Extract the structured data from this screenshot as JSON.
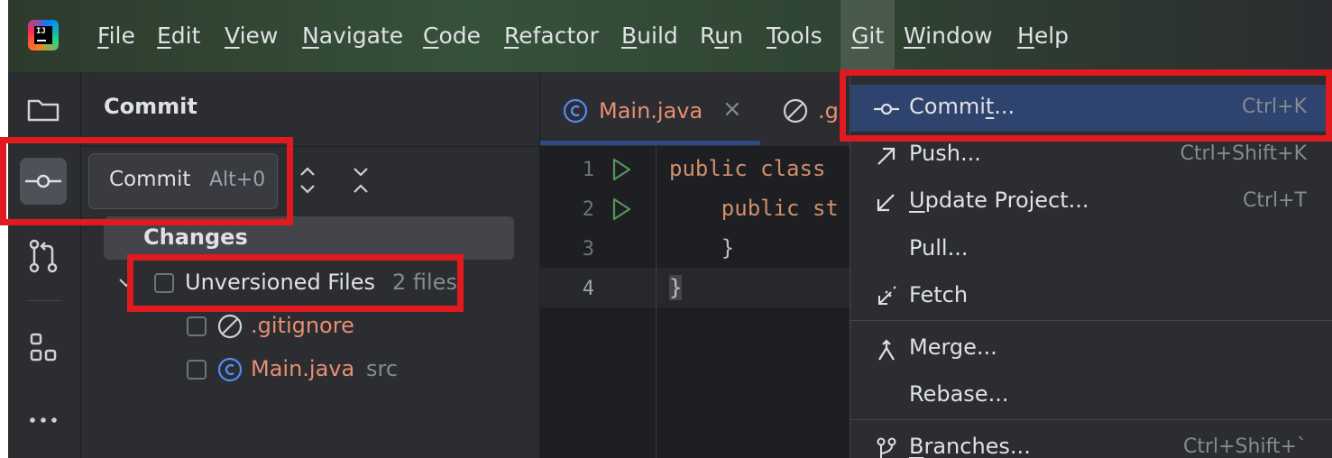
{
  "menubar": {
    "items": [
      {
        "prefix": "",
        "ul": "F",
        "rest": "ile"
      },
      {
        "prefix": "",
        "ul": "E",
        "rest": "dit"
      },
      {
        "prefix": "",
        "ul": "V",
        "rest": "iew"
      },
      {
        "prefix": "",
        "ul": "N",
        "rest": "avigate"
      },
      {
        "prefix": "",
        "ul": "C",
        "rest": "ode"
      },
      {
        "prefix": "",
        "ul": "R",
        "rest": "efactor"
      },
      {
        "prefix": "",
        "ul": "B",
        "rest": "uild"
      },
      {
        "prefix": "R",
        "ul": "u",
        "rest": "n"
      },
      {
        "prefix": "",
        "ul": "T",
        "rest": "ools"
      },
      {
        "prefix": "",
        "ul": "G",
        "rest": "it"
      },
      {
        "prefix": "",
        "ul": "W",
        "rest": "indow"
      },
      {
        "prefix": "",
        "ul": "H",
        "rest": "elp"
      }
    ],
    "logo_text": "IJ"
  },
  "toolstrip": {
    "icons": [
      "folder-icon",
      "commit-icon",
      "pull-requests-icon",
      "structure-icon",
      "more-icon"
    ]
  },
  "panel": {
    "title": "Commit",
    "tooltip": {
      "label": "Commit",
      "shortcut": "Alt+0"
    },
    "changes_label": "Changes",
    "unversioned": {
      "label": "Unversioned Files",
      "count": "2 files"
    },
    "files": [
      {
        "name": ".gitignore",
        "location": ""
      },
      {
        "name": "Main.java",
        "location": "src"
      }
    ]
  },
  "editor": {
    "tabs": [
      {
        "label": "Main.java"
      },
      {
        "label": ".g"
      }
    ],
    "lines": [
      {
        "num": "1",
        "code": "public class"
      },
      {
        "num": "2",
        "code": "    public st"
      },
      {
        "num": "3",
        "code": "    }"
      },
      {
        "num": "4",
        "code": "}"
      }
    ]
  },
  "git_menu": {
    "items": [
      {
        "pre": "Commi",
        "ul": "t",
        "post": "...",
        "shortcut": "Ctrl+K"
      },
      {
        "pre": "Push...",
        "ul": "",
        "post": "",
        "shortcut": "Ctrl+Shift+K"
      },
      {
        "pre": "",
        "ul": "U",
        "post": "pdate Project...",
        "shortcut": "Ctrl+T"
      },
      {
        "pre": "Pull...",
        "ul": "",
        "post": "",
        "shortcut": ""
      },
      {
        "pre": "Fetch",
        "ul": "",
        "post": "",
        "shortcut": ""
      },
      {
        "pre": "Merge...",
        "ul": "",
        "post": "",
        "shortcut": ""
      },
      {
        "pre": "Rebase...",
        "ul": "",
        "post": "",
        "shortcut": ""
      },
      {
        "pre": "",
        "ul": "B",
        "post": "ranches...",
        "shortcut": "Ctrl+Shift+`"
      }
    ]
  },
  "colors": {
    "highlight_red": "#e11a1f",
    "accent_blue": "#3574f0",
    "untracked_file": "#e88e72",
    "keyword": "#cf8e6d"
  }
}
